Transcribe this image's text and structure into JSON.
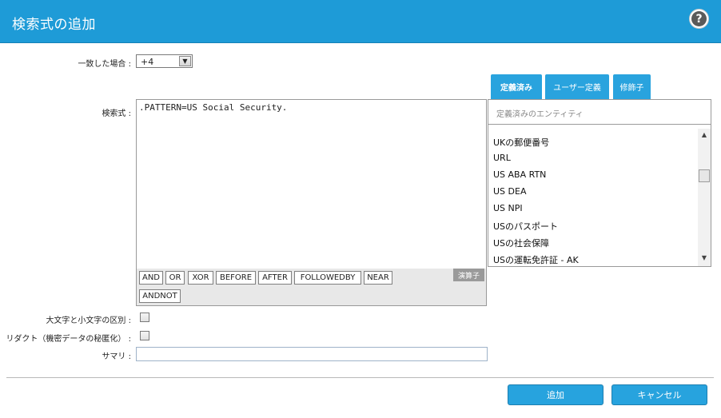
{
  "header": {
    "title": "検索式の追加",
    "help_icon": "?"
  },
  "form": {
    "match_label": "一致した場合 :",
    "match_value": "+4",
    "expression_label": "検索式 :",
    "expression_value": ".PATTERN=US Social Security.",
    "case_label": "大文字と小文字の区別 :",
    "redact_label": "リダクト（機密データの秘匿化） :",
    "summary_label": "サマリ :",
    "summary_value": ""
  },
  "tabs": [
    {
      "label": "定義済み",
      "active": true
    },
    {
      "label": "ユーザー定義",
      "active": false
    },
    {
      "label": "修飾子",
      "active": false
    }
  ],
  "operators": {
    "label": "演算子",
    "buttons": [
      "AND",
      "OR",
      "XOR",
      "BEFORE",
      "AFTER",
      "FOLLOWEDBY",
      "NEAR",
      "ANDNOT"
    ]
  },
  "entities": {
    "placeholder": "定義済みのエンティティ",
    "items": [
      "UKの郵便番号",
      "URL",
      "US ABA RTN",
      "US DEA",
      "US NPI",
      "USのパスポート",
      "USの社会保障",
      "USの運転免許証 - AK"
    ]
  },
  "actions": {
    "add": "追加",
    "cancel": "キャンセル"
  },
  "colors": {
    "header": "#1e9bd7",
    "tab": "#29a3de",
    "button": "#27a3de"
  }
}
